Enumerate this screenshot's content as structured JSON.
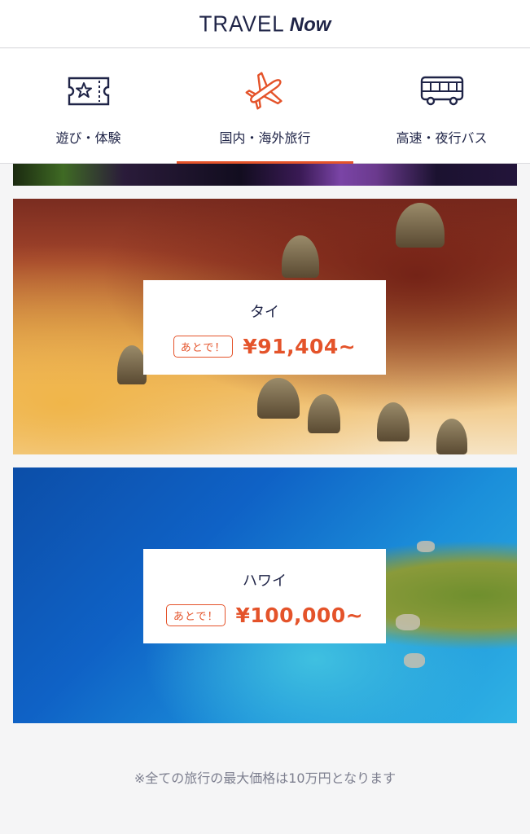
{
  "header": {
    "logo_part1": "TRAVEL",
    "logo_part2": "Now"
  },
  "tabs": [
    {
      "label": "遊び・体験",
      "icon": "ticket-icon",
      "active": false
    },
    {
      "label": "国内・海外旅行",
      "icon": "airplane-icon",
      "active": true
    },
    {
      "label": "高速・夜行バス",
      "icon": "bus-icon",
      "active": false
    }
  ],
  "destinations": [
    {
      "name": "タイ",
      "badge": "あとで！",
      "price": "¥91,404~"
    },
    {
      "name": "ハワイ",
      "badge": "あとで！",
      "price": "¥100,000~"
    }
  ],
  "footer": {
    "note": "※全ての旅行の最大価格は10万円となります"
  },
  "colors": {
    "accent": "#e4532a",
    "navy": "#1f2447",
    "background": "#f5f5f6"
  }
}
